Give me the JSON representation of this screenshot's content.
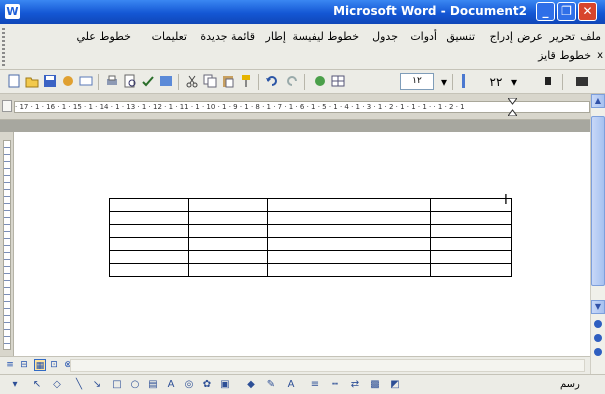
{
  "window": {
    "title": "Microsoft Word - Document2",
    "min_glyph": "_",
    "max_glyph": "❐",
    "close_glyph": "✕"
  },
  "menu": {
    "items": [
      "ملف",
      "تحرير",
      "عرض",
      "إدراج",
      "تنسيق",
      "أدوات",
      "جدول",
      "خطوط ليفيسة",
      "إطار",
      "قائمة جديدة",
      "تعليمات",
      "خطوط علي"
    ],
    "row2": "خطوط قايز",
    "close": "x"
  },
  "toolbar": {
    "icons": [
      "new-doc-icon",
      "open-icon",
      "save-icon",
      "permission-icon",
      "email-icon",
      "print-icon",
      "print-preview-icon",
      "spelling-icon",
      "research-icon",
      "cut-icon",
      "copy-icon",
      "paste-icon",
      "format-painter-icon",
      "undo-icon",
      "redo-icon",
      "hyperlink-icon"
    ],
    "font_size": "١٢",
    "right_label": "٢٢"
  },
  "ruler": {
    "text": "· 17 · 1 · 16 · 1 · 15 · 1 · 14 · 1 · 13 · 1 · 12 · 1 · 11 · 1 · 10 · 1 · 9 · 1 · 8 · 1 · 7 · 1 · 6 · 1 · 5 · 1 · 4 · 1 · 3 · 1 · 2 · 1 · 1 · 1 · · 1 · 2 · 1"
  },
  "document": {
    "table_rows": 6,
    "table_cols": 4,
    "cursor_glyph": "I"
  },
  "viewbar": {
    "buttons": [
      "≡",
      "⊟",
      "▦",
      "⊡",
      "⊗"
    ]
  },
  "drawbar": {
    "label": "رسم"
  },
  "colors": {
    "titlebar": "#1457d4",
    "chrome": "#ecece6",
    "close": "#d8452c"
  }
}
